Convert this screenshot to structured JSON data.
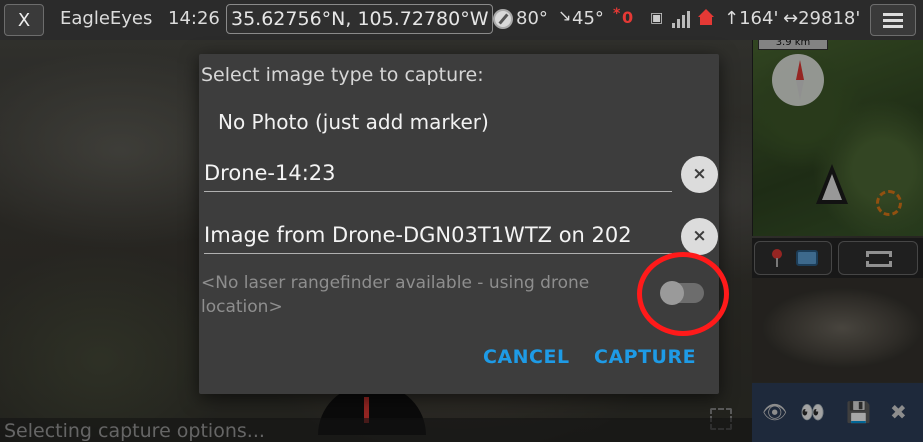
{
  "topbar": {
    "close_label": "X",
    "app_name": "EagleEyes",
    "time": "14:26",
    "coordinates": "35.62756°N, 105.72780°W",
    "heading": "80°",
    "pitch": "45°",
    "record_count": "0",
    "altitude": "↑164'",
    "distance": "↔29818'"
  },
  "map": {
    "scale_label": "3.9 km"
  },
  "dialog": {
    "title": "Select image type to capture:",
    "option_no_photo": "No Photo (just add marker)",
    "marker_name": "Drone-14:23",
    "marker_description": "Image from Drone-DGN03T1WTZ on 202",
    "clear_symbol": "×",
    "laser_note": "<No laser rangefinder available - using drone location>",
    "laser_toggle_on": false,
    "cancel_label": "CANCEL",
    "capture_label": "CAPTURE"
  },
  "status": {
    "text": "Selecting capture options..."
  },
  "tools": {
    "eye": "👁",
    "eyes": "👀",
    "save": "💾",
    "close": "✖"
  },
  "colors": {
    "accent_button_text": "#1e9be6",
    "highlight_circle": "#ff1a1a"
  }
}
